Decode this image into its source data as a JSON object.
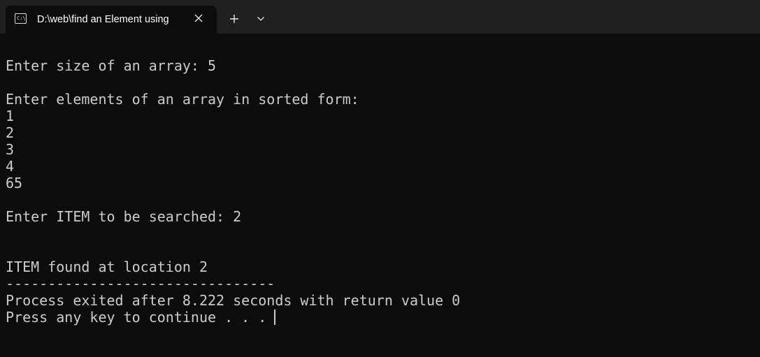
{
  "window": {
    "tab_title": "D:\\web\\find an Element using",
    "tab_icon": "console-icon",
    "close_icon": "close-icon",
    "new_tab_icon": "plus-icon",
    "dropdown_icon": "chevron-down-icon"
  },
  "terminal": {
    "lines": [
      "Enter size of an array: 5",
      "Enter elements of an array in sorted form:",
      "1",
      "2",
      "3",
      "4",
      "65",
      "Enter ITEM to be searched: 2",
      "ITEM found at location 2",
      "--------------------------------",
      "Process exited after 8.222 seconds with return value 0",
      "Press any key to continue . . . "
    ]
  },
  "colors": {
    "background": "#0c0c0c",
    "titlebar": "#1f1f1f",
    "text": "#cccccc"
  }
}
